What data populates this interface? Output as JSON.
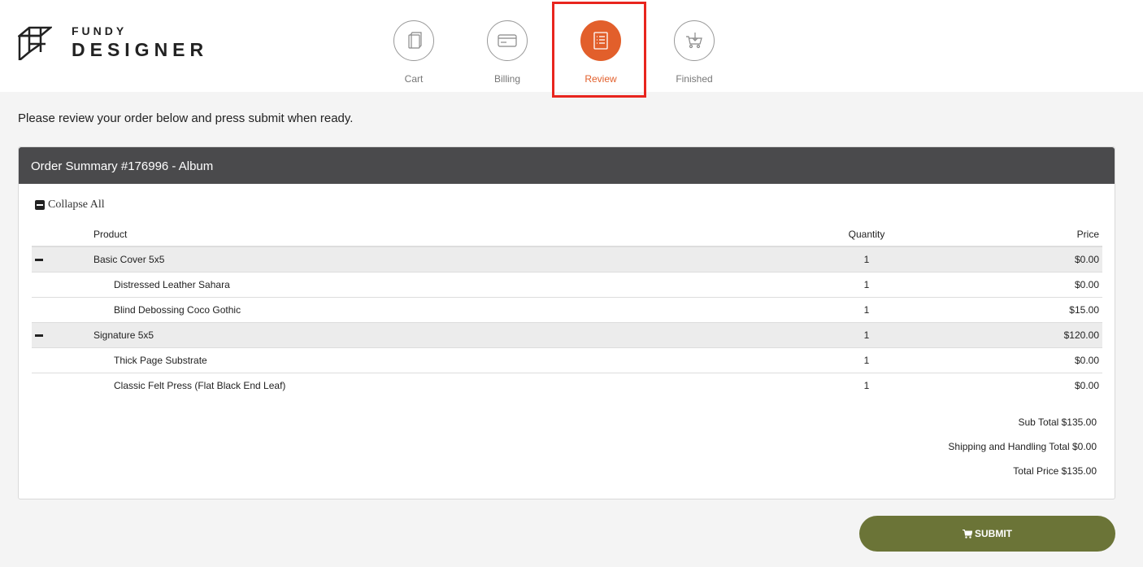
{
  "brand": {
    "top": "FUNDY",
    "bottom": "DESIGNER"
  },
  "steps": [
    {
      "label": "Cart",
      "icon": "book-icon",
      "active": false
    },
    {
      "label": "Billing",
      "icon": "credit-card-icon",
      "active": false
    },
    {
      "label": "Review",
      "icon": "list-icon",
      "active": true
    },
    {
      "label": "Finished",
      "icon": "cart-icon",
      "active": false
    }
  ],
  "intro": "Please review your order below and press submit when ready.",
  "order": {
    "title": "Order Summary #176996 - Album",
    "collapse_label": "Collapse All",
    "columns": {
      "product": "Product",
      "quantity": "Quantity",
      "price": "Price"
    },
    "rows": [
      {
        "name": "Basic Cover 5x5",
        "qty": "1",
        "price": "$0.00",
        "group": true
      },
      {
        "name": "Distressed Leather Sahara",
        "qty": "1",
        "price": "$0.00",
        "group": false
      },
      {
        "name": "Blind Debossing Coco Gothic",
        "qty": "1",
        "price": "$15.00",
        "group": false
      },
      {
        "name": "Signature 5x5",
        "qty": "1",
        "price": "$120.00",
        "group": true
      },
      {
        "name": "Thick Page Substrate",
        "qty": "1",
        "price": "$0.00",
        "group": false
      },
      {
        "name": "Classic Felt Press (Flat Black End Leaf)",
        "qty": "1",
        "price": "$0.00",
        "group": false
      }
    ],
    "totals": {
      "subtotal": "Sub Total $135.00",
      "shipping": "Shipping and Handling Total $0.00",
      "total": "Total Price $135.00"
    }
  },
  "submit_label": "SUBMIT",
  "colors": {
    "accent": "#e25f2b",
    "header_bar": "#4a4a4c",
    "submit": "#6b7437",
    "highlight": "#e8251e"
  }
}
